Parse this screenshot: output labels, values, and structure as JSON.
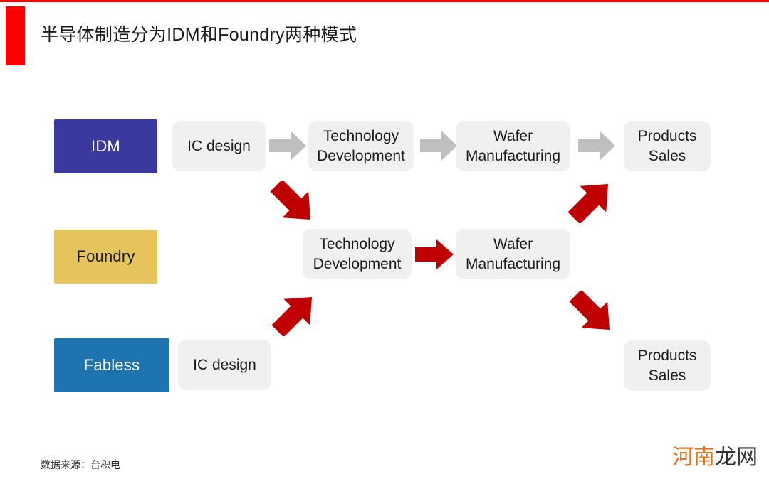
{
  "slide": {
    "title": "半导体制造分为IDM和Foundry两种模式",
    "accent_color": "#fe0000",
    "background": "#ffffff"
  },
  "categories": [
    {
      "id": "idm",
      "label": "IDM",
      "fill": "#3a3a9e",
      "text_color": "#ffffff"
    },
    {
      "id": "foundry",
      "label": "Foundry",
      "fill": "#e5c45b",
      "text_color": "#1a1a1a"
    },
    {
      "id": "fabless",
      "label": "Fabless",
      "fill": "#1d74ae",
      "text_color": "#ffffff"
    }
  ],
  "rows": [
    {
      "id": "idm-row",
      "category": "IDM",
      "stages": [
        {
          "id": "idm-ic-design",
          "lines": [
            "IC design"
          ]
        },
        {
          "id": "idm-tech-dev",
          "lines": [
            "Technology",
            "Development"
          ]
        },
        {
          "id": "idm-wafer-mfg",
          "lines": [
            "Wafer",
            "Manufacturing"
          ]
        },
        {
          "id": "idm-products",
          "lines": [
            "Products",
            "Sales"
          ]
        }
      ]
    },
    {
      "id": "foundry-row",
      "category": "Foundry",
      "stages": [
        {
          "id": "foundry-tech-dev",
          "lines": [
            "Technology",
            "Development"
          ]
        },
        {
          "id": "foundry-wafer-mfg",
          "lines": [
            "Wafer",
            "Manufacturing"
          ]
        }
      ]
    },
    {
      "id": "fabless-row",
      "category": "Fabless",
      "stages": [
        {
          "id": "fabless-ic-design",
          "lines": [
            "IC design"
          ]
        },
        {
          "id": "fabless-products",
          "lines": [
            "Products",
            "Sales"
          ]
        }
      ]
    }
  ],
  "arrows": [
    {
      "id": "idm-arrow-1",
      "style": "gray",
      "direction": "right",
      "color": "#bfbfbf"
    },
    {
      "id": "idm-arrow-2",
      "style": "gray",
      "direction": "right",
      "color": "#bfbfbf"
    },
    {
      "id": "idm-arrow-3",
      "style": "gray",
      "direction": "right",
      "color": "#bfbfbf"
    },
    {
      "id": "idm-to-foundry",
      "style": "red",
      "direction": "down-right",
      "color": "#c00000"
    },
    {
      "id": "foundry-arrow-mid",
      "style": "red",
      "direction": "right",
      "color": "#c00000"
    },
    {
      "id": "foundry-to-idm-sales",
      "style": "red",
      "direction": "up-right",
      "color": "#c00000"
    },
    {
      "id": "fabless-to-foundry",
      "style": "red",
      "direction": "up-right",
      "color": "#c00000"
    },
    {
      "id": "foundry-to-fabless-sales",
      "style": "red",
      "direction": "down-right",
      "color": "#c00000"
    }
  ],
  "footer": {
    "source_note": "数据来源：台积电",
    "watermark_part1": "河南",
    "watermark_part2": "龙网",
    "watermark_color1": "#e8701a",
    "watermark_color2": "#333333"
  }
}
